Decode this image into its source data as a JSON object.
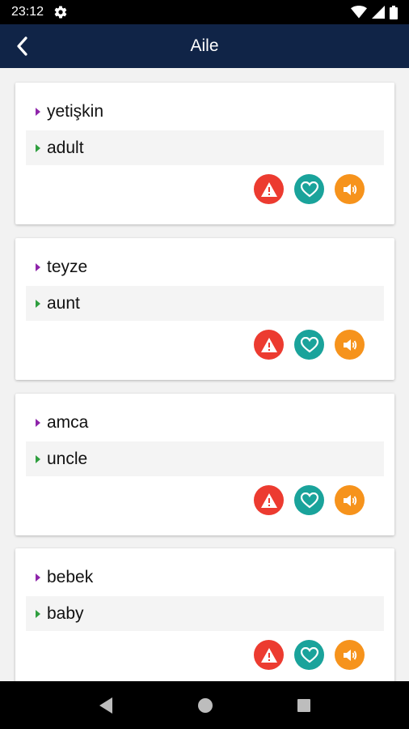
{
  "status_bar": {
    "time": "23:12"
  },
  "app_bar": {
    "title": "Aile"
  },
  "cards": [
    {
      "source": "yetişkin",
      "target": "adult"
    },
    {
      "source": "teyze",
      "target": "aunt"
    },
    {
      "source": "amca",
      "target": "uncle"
    },
    {
      "source": "bebek",
      "target": "baby"
    }
  ],
  "colors": {
    "app_bar": "#102447",
    "report": "#ec3b30",
    "favorite": "#1aa39b",
    "speak": "#f6931c",
    "source_marker": "#8e24aa",
    "target_marker": "#2e9e3e"
  },
  "icons": {
    "report": "warning-icon",
    "favorite": "heart-icon",
    "speak": "speaker-icon",
    "back": "chevron-left-icon"
  }
}
